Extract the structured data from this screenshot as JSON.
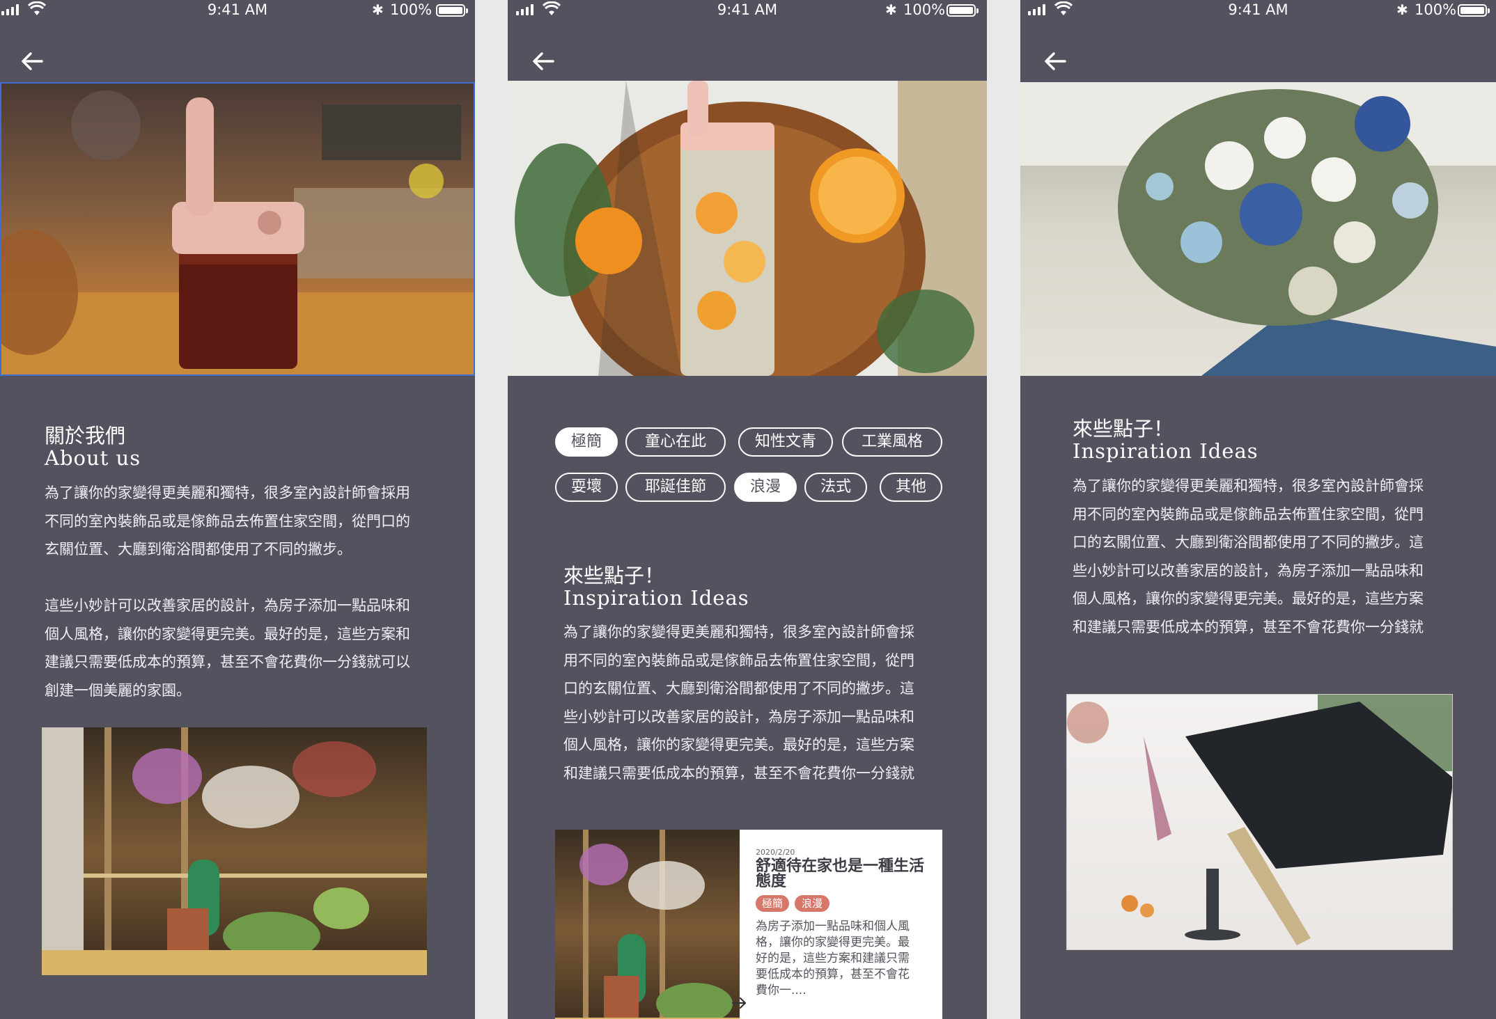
{
  "status_bar": {
    "time": "9:41 AM",
    "battery": "100%",
    "bluetooth": "bluetooth-icon",
    "signal": "signal-icon",
    "wifi": "wifi-icon"
  },
  "colors": {
    "background": "#54525e",
    "text": "#ffffff",
    "chip_active_bg": "#ffffff",
    "tag_bg": "#d6776a",
    "card_bg": "#ffffff"
  },
  "screen1": {
    "title_zh": "關於我們",
    "title_en": "About us",
    "paragraph1": "為了讓你的家變得更美麗和獨特，很多室內設計師會採用\n不同的室內裝飾品或是傢飾品去佈置住家空間，從門口的\n玄關位置、大廳到衛浴間都使用了不同的撇步。",
    "paragraph2": "這些小妙計可以改善家居的設計，為房子添加一點品味和\n個人風格，讓你的家變得更完美。最好的是，這些方案和\n建議只需要低成本的預算，甚至不會花費你一分錢就可以\n創建一個美麗的家園。"
  },
  "screen2": {
    "tags": [
      {
        "label": "極簡",
        "active": true
      },
      {
        "label": "童心在此",
        "active": false
      },
      {
        "label": "知性文青",
        "active": false
      },
      {
        "label": "工業風格",
        "active": false
      },
      {
        "label": "耍壞",
        "active": false
      },
      {
        "label": "耶誕佳節",
        "active": false
      },
      {
        "label": "浪漫",
        "active": true
      },
      {
        "label": "法式",
        "active": false
      },
      {
        "label": "其他",
        "active": false
      }
    ],
    "title_zh": "來些點子！",
    "title_en": "Inspiration Ideas",
    "paragraph": "為了讓你的家變得更美麗和獨特，很多室內設計師會採\n用不同的室內裝飾品或是傢飾品去佈置住家空間，從門\n口的玄關位置、大廳到衛浴間都使用了不同的撇步。這\n些小妙計可以改善家居的設計，為房子添加一點品味和\n個人風格，讓你的家變得更完美。最好的是，這些方案\n和建議只需要低成本的預算，甚至不會花費你一分錢就",
    "card": {
      "date": "2020/2/20",
      "title": "舒適待在家也是一種生活態度",
      "tags": [
        "極簡",
        "浪漫"
      ],
      "excerpt": "為房子添加一點品味和個人風\n格，讓你的家變得更完美。最\n好的是，這些方案和建議只需\n要低成本的預算，甚至不會花\n費你一....",
      "arrow": "arrow-right-icon"
    }
  },
  "screen3": {
    "title_zh": "來些點子！",
    "title_en": "Inspiration Ideas",
    "paragraph": "為了讓你的家變得更美麗和獨特，很多室內設計師會採\n用不同的室內裝飾品或是傢飾品去佈置住家空間，從門\n口的玄關位置、大廳到衛浴間都使用了不同的撇步。這\n些小妙計可以改善家居的設計，為房子添加一點品味和\n個人風格，讓你的家變得更完美。最好的是，這些方案\n和建議只需要低成本的預算，甚至不會花費你一分錢就"
  }
}
